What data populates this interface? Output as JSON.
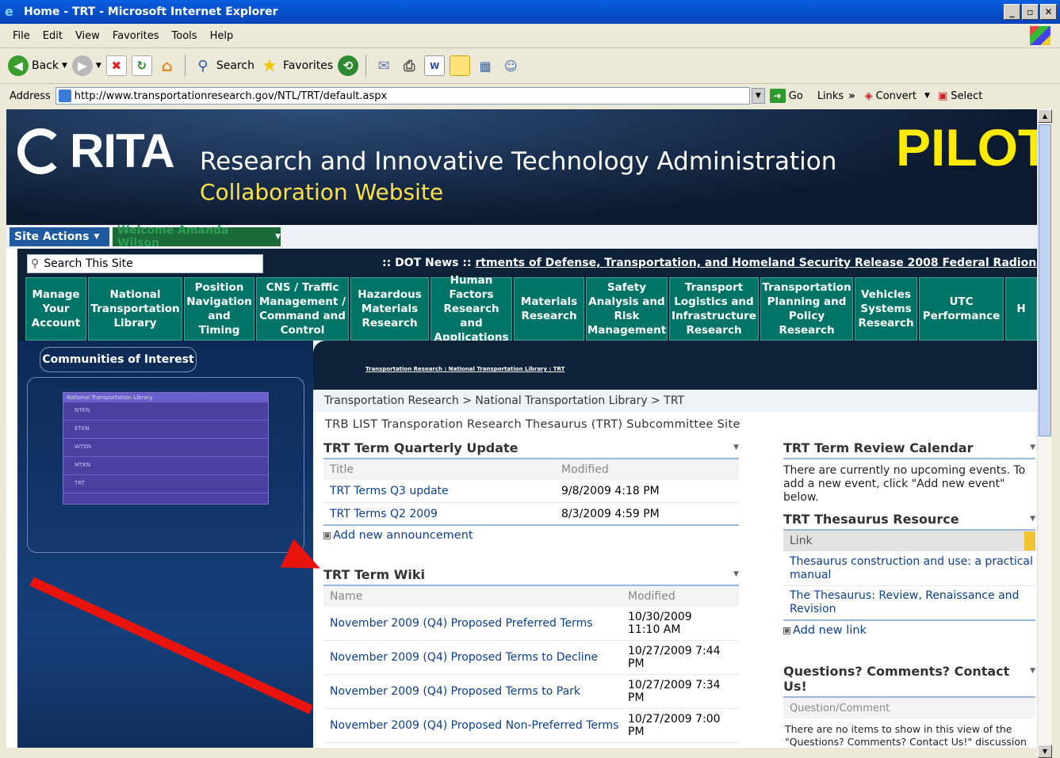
{
  "window": {
    "title": "Home - TRT - Microsoft Internet Explorer"
  },
  "menu": [
    "File",
    "Edit",
    "View",
    "Favorites",
    "Tools",
    "Help"
  ],
  "toolbar": {
    "back": "Back",
    "search": "Search",
    "favorites": "Favorites"
  },
  "address": {
    "label": "Address",
    "url": "http://www.transportationresearch.gov/NTL/TRT/default.aspx",
    "go": "Go",
    "links": "Links",
    "convert": "Convert",
    "select": "Select"
  },
  "banner": {
    "logo": "RITA",
    "title": "Research and Innovative Technology Administration",
    "subtitle": "Collaboration Website",
    "pilot": "PILOT"
  },
  "actions": {
    "site_actions": "Site Actions",
    "welcome": "Welcome Amanda Wilson"
  },
  "search": {
    "placeholder": "Search This Site"
  },
  "news": {
    "label": ":: DOT News ::",
    "text": "rtments of Defense, Transportation, and Homeland Security Release 2008 Federal Radionavigation Pl"
  },
  "tabs": [
    {
      "label": "Manage Your Account"
    },
    {
      "label": "National Transportation Library"
    },
    {
      "label": "Position Navigation and Timing"
    },
    {
      "label": "CNS / Traffic Management / Command and Control"
    },
    {
      "label": "Hazardous Materials Research"
    },
    {
      "label": "Human Factors Research and Applications"
    },
    {
      "label": "Materials Research"
    },
    {
      "label": "Safety Analysis and Risk Management"
    },
    {
      "label": "Transport Logistics and Infrastructure Research"
    },
    {
      "label": "Transportation Planning and Policy Research"
    },
    {
      "label": "Vehicles Systems Research"
    },
    {
      "label": "UTC Performance"
    },
    {
      "label": "H"
    }
  ],
  "left": {
    "coi": "Communities of Interest",
    "menu_header": "National Transportation Library",
    "menu_items": [
      "NTKN",
      "ETKN",
      "WTKN",
      "MTKN",
      "TRT"
    ]
  },
  "content": {
    "small_crumb": "Transportation Research : National Transportation Library : TRT",
    "breadcrumb": "Transportation Research > National Transportation Library > TRT",
    "site_title": "TRB LIST Transporation Research Thesaurus (TRT) Subcommittee Site",
    "quarterly": {
      "title": "TRT Term Quarterly Update",
      "col_title": "Title",
      "col_modified": "Modified",
      "rows": [
        {
          "title": "TRT Terms Q3 update",
          "modified": "9/8/2009 4:18 PM"
        },
        {
          "title": "TRT Terms Q2 2009",
          "modified": "8/3/2009 4:59 PM"
        }
      ],
      "add": "Add new announcement"
    },
    "wiki": {
      "title": "TRT Term Wiki",
      "col_name": "Name",
      "col_modified": "Modified",
      "rows": [
        {
          "name": "November 2009 (Q4) Proposed Preferred Terms",
          "modified": "10/30/2009 11:10 AM"
        },
        {
          "name": "November 2009 (Q4) Proposed Terms to Decline",
          "modified": "10/27/2009 7:44 PM"
        },
        {
          "name": "November 2009 (Q4) Proposed Terms to Park",
          "modified": "10/27/2009 7:34 PM"
        },
        {
          "name": "November 2009 (Q4) Proposed Non-Preferred Terms",
          "modified": "10/27/2009 7:00 PM"
        }
      ]
    },
    "calendar": {
      "title": "TRT Term Review Calendar",
      "text": "There are currently no upcoming events. To add a new event, click \"Add new event\" below."
    },
    "resource": {
      "title": "TRT Thesaurus Resource",
      "col_link": "Link",
      "links": [
        "Thesaurus construction and use: a practical manual",
        "The Thesaurus: Review, Renaissance and Revision"
      ],
      "add": "Add new link"
    },
    "questions": {
      "title": "Questions? Comments? Contact Us!",
      "col": "Question/Comment",
      "text": "There are no items to show in this view of the \"Questions? Comments? Contact Us!\" discussion board. To create a new item, click \"Add new"
    }
  }
}
